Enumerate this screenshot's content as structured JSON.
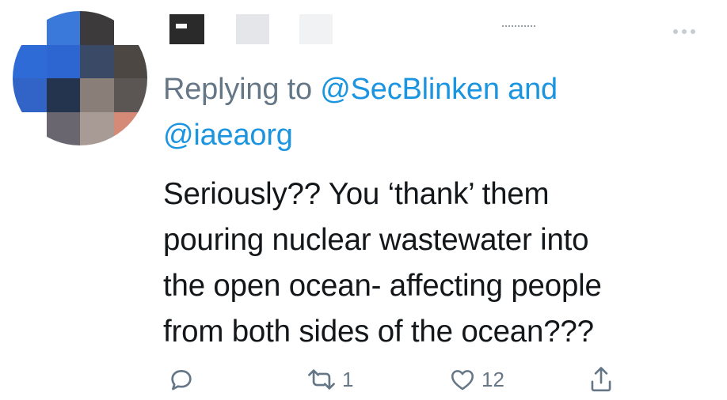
{
  "tweet": {
    "replying_prefix": "Replying to ",
    "mentions": [
      "@SecBlinken",
      "@iaeaorg"
    ],
    "mention_joiner": " and",
    "text_lines": [
      "Seriously?? You ‘thank’ them",
      "pouring nuclear wastewater into",
      "the open ocean- affecting people",
      "from both sides of the ocean???"
    ]
  },
  "actions": {
    "reply": {
      "icon": "reply-icon",
      "count": ""
    },
    "retweet": {
      "icon": "retweet-icon",
      "count": "1"
    },
    "like": {
      "icon": "heart-icon",
      "count": "12"
    },
    "share": {
      "icon": "share-icon",
      "count": ""
    }
  },
  "colors": {
    "mention": "#1b95e0",
    "secondary": "#657786",
    "text": "#14171a"
  },
  "avatar": {
    "pixels": [
      "#ffffff",
      "#3a78d9",
      "#3c3a3a",
      "#ffffff",
      "#2f6bd6",
      "#2e66d1",
      "#3a4a66",
      "#4c4742",
      "#3164c6",
      "#24344e",
      "#8a7e78",
      "#5b5553",
      "#ffffff",
      "#6a6670",
      "#a89a95",
      "#d58a78"
    ]
  }
}
